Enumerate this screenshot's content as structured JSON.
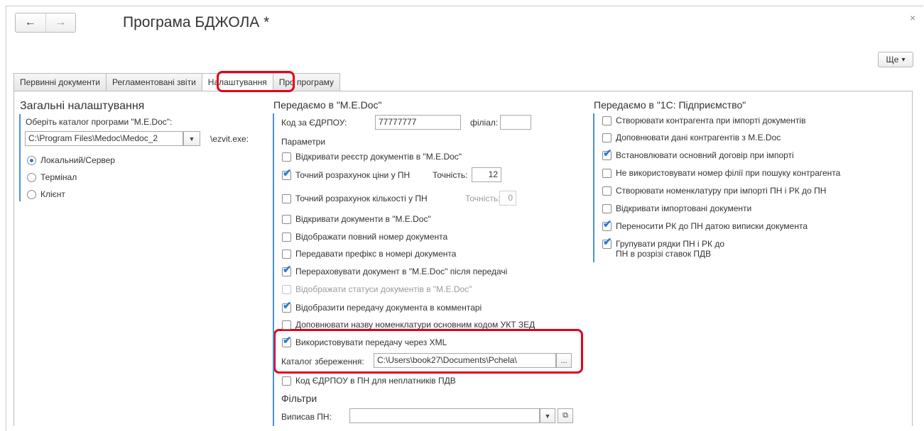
{
  "window": {
    "title": "Програма БДЖОЛА *",
    "back_icon": "arrow-left-icon",
    "forward_icon": "arrow-right-icon",
    "close_glyph": "×",
    "more_label": "Ще",
    "more_arrow": "▾"
  },
  "tabs": [
    {
      "label": "Первинні документи",
      "active": false
    },
    {
      "label": "Регламентовані звіти",
      "active": false
    },
    {
      "label": "Налаштування",
      "active": true
    },
    {
      "label": "Про програму",
      "active": false
    }
  ],
  "general": {
    "title": "Загальні налаштування",
    "catalog_label": "Оберіть каталог програми \"M.E.Doc\":",
    "catalog_value": "C:\\Program Files\\Medoc\\Medoc_2",
    "exe_suffix": "\\ezvit.exe:",
    "radios": [
      {
        "label": "Локальний/Сервер",
        "selected": true
      },
      {
        "label": "Термінал",
        "selected": false
      },
      {
        "label": "Клієнт",
        "selected": false
      }
    ]
  },
  "medoc": {
    "title": "Передаємо в \"M.E.Doc\"",
    "edrpou_label": "Код за ЄДРПОУ:",
    "edrpou_value": "77777777",
    "filial_label": "філіал:",
    "filial_value": "",
    "params_label": "Параметри",
    "options": [
      {
        "label": "Відкривати реєстр документів в \"M.E.Doc\"",
        "checked": false,
        "disabled": false
      },
      {
        "label": "Точний розрахунок ціни у ПН",
        "checked": true,
        "disabled": false
      },
      {
        "label": "Точний розрахунок кількості у ПН",
        "checked": false,
        "disabled": false
      },
      {
        "label": "Відкривати документи в \"M.E.Doc\"",
        "checked": false,
        "disabled": false
      },
      {
        "label": "Відображати повний номер документа",
        "checked": false,
        "disabled": false
      },
      {
        "label": "Передавати префікс в номері документа",
        "checked": false,
        "disabled": false
      },
      {
        "label": "Перераховувати документ в \"M.E.Doc\" після передачі",
        "checked": true,
        "disabled": false
      },
      {
        "label": "Відображати статуси документів в \"M.E.Doc\"",
        "checked": false,
        "disabled": true
      },
      {
        "label": "Відобразити передачу документа в комментарі",
        "checked": true,
        "disabled": false
      },
      {
        "label": "Доповнювати назву номенклатури основним кодом УКТ ЗЕД",
        "checked": false,
        "disabled": false
      },
      {
        "label": "Використовувати передачу через XML",
        "checked": true,
        "disabled": false
      }
    ],
    "price_precision_label": "Точність:",
    "price_precision_value": "12",
    "qty_precision_label": "Точність:",
    "qty_precision_value": "0",
    "save_dir_label": "Каталог збереження:",
    "save_dir_value": "C:\\Users\\book27\\Documents\\Pchela\\",
    "browse_label": "...",
    "nonpayer_label": "Код ЄДРПОУ в ПН для неплатників ПДВ",
    "nonpayer_checked": false,
    "filters_title": "Фільтри",
    "issued_label": "Виписав ПН:",
    "issued_value": ""
  },
  "onec": {
    "title": "Передаємо в \"1С: Підприємство\"",
    "options": [
      {
        "label": "Створювати контрагента при імпорті документів",
        "checked": false
      },
      {
        "label": "Доповнювати дані контрагентів з M.E.Doc",
        "checked": false
      },
      {
        "label": "Встановлювати основний договір при імпорті",
        "checked": true
      },
      {
        "label": "Не використовувати номер філії при пошуку контрагента",
        "checked": false
      },
      {
        "label": "Створювати номенклатуру при імпорті ПН і РК до ПН",
        "checked": false
      },
      {
        "label": "Відкривати імпортовані документи",
        "checked": false
      },
      {
        "label": "Переносити РК до ПН датою виписки документа",
        "checked": true
      }
    ],
    "group_line1": "Групувати рядки ПН і РК до",
    "group_line2": "ПН в розрізі ставок ПДВ",
    "group_checked": true
  },
  "colors": {
    "highlight": "#e3001b",
    "accent": "#4a90d9",
    "check": "#2a7bd4"
  }
}
